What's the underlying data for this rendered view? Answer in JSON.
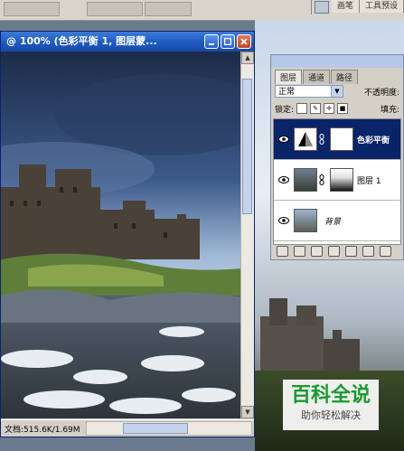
{
  "top_bar": {
    "palette_tabs": [
      "画笔",
      "工具预设"
    ]
  },
  "document": {
    "title": "@ 100% (色彩平衡 1, 图层蒙...",
    "status": "文档:515.6K/1.69M"
  },
  "layers_panel": {
    "tabs": [
      "图层",
      "通道",
      "路径"
    ],
    "active_tab": "图层",
    "blend_mode": "正常",
    "opacity_label": "不透明度:",
    "lock_label": "锁定:",
    "fill_label": "填充:",
    "layers": [
      {
        "name": "色彩平衡",
        "selected": true,
        "icon": "color-balance-adjustment"
      },
      {
        "name": "图层 1",
        "selected": false,
        "icon": "layer-with-mask"
      },
      {
        "name": "背景",
        "selected": false,
        "icon": "background-photo"
      }
    ]
  },
  "watermark": {
    "brand": "百科全说",
    "sub": "助你轻松解决",
    "brand_color": "#1a9a2e"
  },
  "colors": {
    "titlebar": "#1f5dc4",
    "selected_layer": "#0a246a"
  }
}
